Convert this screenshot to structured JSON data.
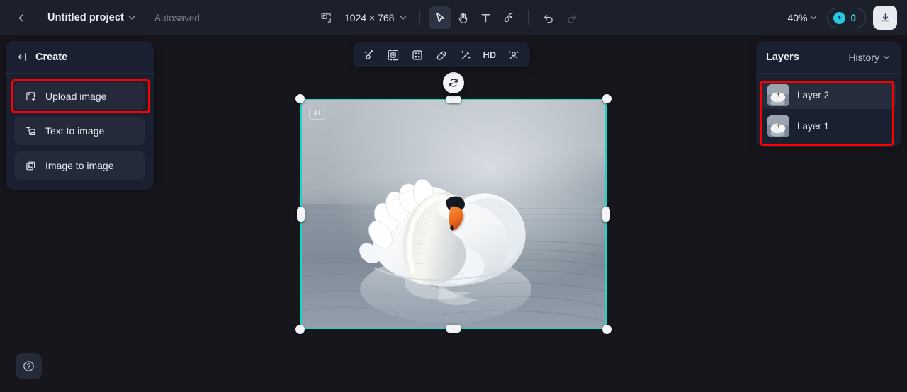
{
  "topbar": {
    "back_icon": "chevron-left-icon",
    "project_name": "Untitled project",
    "project_caret_icon": "chevron-down-icon",
    "autosave_status": "Autosaved",
    "canvas_size_icon": "resize-canvas-icon",
    "canvas_size": "1024 × 768",
    "canvas_size_caret_icon": "chevron-down-icon",
    "tools": [
      {
        "name": "select-tool",
        "icon": "cursor-arrow-icon",
        "active": true
      },
      {
        "name": "hand-tool",
        "icon": "hand-icon",
        "active": false
      },
      {
        "name": "text-tool",
        "icon": "text-t-icon",
        "active": false
      },
      {
        "name": "brush-tool",
        "icon": "brush-icon",
        "active": false
      }
    ],
    "undo_icon": "undo-arrow-icon",
    "redo_icon": "redo-arrow-icon",
    "zoom_level": "40%",
    "zoom_caret_icon": "chevron-down-icon",
    "credits_icon": "credit-coin-icon",
    "credits_count": "0",
    "download_icon": "download-icon"
  },
  "sidebar": {
    "collapse_icon": "collapse-panel-icon",
    "title": "Create",
    "items": [
      {
        "label": "Upload image",
        "icon": "upload-image-icon",
        "highlighted": true
      },
      {
        "label": "Text to image",
        "icon": "text-to-image-icon",
        "highlighted": false
      },
      {
        "label": "Image to image",
        "icon": "image-to-image-icon",
        "highlighted": false
      }
    ]
  },
  "help": {
    "icon": "help-question-icon"
  },
  "context_toolbar": {
    "buttons": [
      {
        "name": "magic-retouch-button",
        "icon": "magic-brush-icon",
        "label": ""
      },
      {
        "name": "expand-image-button",
        "icon": "expand-frame-icon",
        "label": ""
      },
      {
        "name": "remove-background-button",
        "icon": "crop-select-icon",
        "label": ""
      },
      {
        "name": "eraser-button",
        "icon": "eraser-icon",
        "label": ""
      },
      {
        "name": "magic-wand-button",
        "icon": "magic-wand-icon",
        "label": ""
      },
      {
        "name": "hd-upscale-button",
        "icon": "hd-text-icon",
        "label": "HD"
      },
      {
        "name": "face-retouch-button",
        "icon": "face-enhance-icon",
        "label": ""
      }
    ]
  },
  "canvas": {
    "selection": {
      "rotate_icon": "rotate-refresh-icon",
      "ai_badge": "AI",
      "border_color": "#19d6c9",
      "handle_color": "#f2f4f7"
    },
    "image_alt": "white mute swan with curved neck on calm gray water with reflection"
  },
  "layers_panel": {
    "title": "Layers",
    "history_label": "History",
    "history_caret_icon": "chevron-down-icon",
    "layers": [
      {
        "name": "Layer 2",
        "selected": true,
        "thumbnail": "swan-thumbnail"
      },
      {
        "name": "Layer 1",
        "selected": false,
        "thumbnail": "swan-thumbnail"
      }
    ]
  },
  "annotations": {
    "color": "#fe0000",
    "boxes": [
      {
        "name": "upload-image-highlight",
        "target": "Upload image"
      },
      {
        "name": "layers-list-highlight",
        "target": "Layers list"
      }
    ]
  }
}
